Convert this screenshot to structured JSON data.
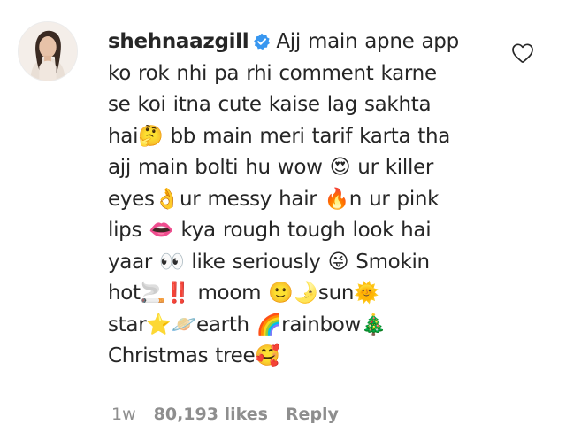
{
  "comment": {
    "username": "shehnaazgill",
    "verified_icon": "verified-badge-icon",
    "lines": [
      "Ajj main apne app",
      "ko rok nhi pa rhi comment karne",
      "se koi itna cute kaise lag sakhta",
      "hai🤔 bb main meri tarif karta tha",
      "ajj main bolti hu wow 😍 ur killer",
      "eyes👌ur messy hair 🔥n ur pink",
      "lips 👄 kya rough tough look hai",
      "yaar 👀 like seriously 😜 Smokin",
      "hot🚬‼️ moom 🙂🌛sun🌞",
      "star⭐🪐earth 🌈rainbow🎄",
      "Christmas tree🥰"
    ]
  },
  "meta": {
    "time": "1w",
    "likes": "80,193 likes",
    "reply": "Reply"
  },
  "icons": {
    "like": "heart-outline-icon",
    "avatar": "profile-picture"
  },
  "colors": {
    "text": "#262626",
    "muted": "#8e8e8e",
    "verified": "#3897f0"
  }
}
